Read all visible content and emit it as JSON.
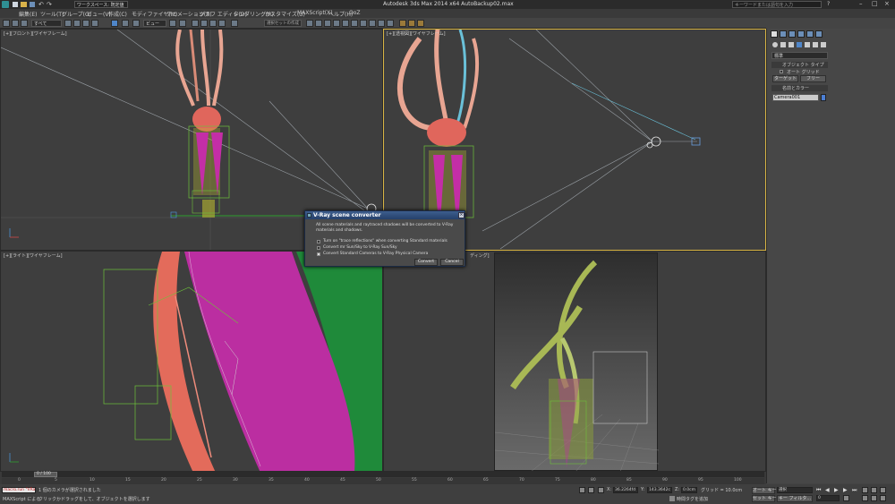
{
  "title_bar": {
    "workspace": "ワークスペース: 既定値",
    "title": "Autodesk 3ds Max 2014 x64   AutoBackup02.max",
    "search_placeholder": "キーワードまたは語句を入力"
  },
  "menu": [
    "編集(E)",
    "ツール(T)",
    "グループ(G)",
    "ビュー(V)",
    "作成(C)",
    "モディファイヤ(M)",
    "アニメーション(A)",
    "グラフ エディタ(D)",
    "レンダリング(R)",
    "カスタマイズ(U)",
    "MAXScript(X)",
    "ヘルプ(H)",
    "OoZ"
  ],
  "toolbar": {
    "selection_filter": "すべて",
    "view_dropdown": "ビュー",
    "named_selection": "選択セットの作成"
  },
  "viewports": {
    "front": "[+][フロント][ワイヤフレーム]",
    "perspective": "[+][透視図][ワイヤフレーム]",
    "right": "[+][ライト][ワイヤフレーム]",
    "camera_suffix": "ディング]"
  },
  "dialog": {
    "title": "V-Ray scene converter",
    "message": "All scene materials and raytraced shadows will be converted to V-Ray materials and shadows.",
    "options": [
      {
        "label": "Turn on \"trace reflections\" when converting Standard materials",
        "checked": false
      },
      {
        "label": "Convert mr Sun/Sky to V-Ray Sun/Sky",
        "checked": false
      },
      {
        "label": "Convert Standard Cameras to V-Ray Physical Camera",
        "checked": true
      }
    ],
    "convert": "Convert",
    "cancel": "Cancel"
  },
  "command_panel": {
    "category_dropdown": "標準",
    "rollout_object_type": "オブジェクト タイプ",
    "autogrid": "オート グリッド",
    "button_target": "ターゲット",
    "button_free": "フリー",
    "rollout_name_color": "名前とカラー",
    "object_name": "Camera001",
    "color": "#4c7fd4"
  },
  "timeline": {
    "frame": "0 / 100",
    "ticks": [
      "0",
      "5",
      "10",
      "15",
      "20",
      "25",
      "30",
      "35",
      "40",
      "45",
      "50",
      "55",
      "60",
      "65",
      "70",
      "75",
      "80",
      "85",
      "90",
      "95",
      "100"
    ]
  },
  "status": {
    "script_label": "macro.run \"VRa",
    "listener_label": "MAXScript による",
    "selected": "1 個のカメラが選択されました",
    "prompt": "クリックかドラッグをして、オブジェクトを選択します",
    "x_label": "X:",
    "x": "36.2264fd",
    "y_label": "Y:",
    "y": "143.3642c",
    "z_label": "Z:",
    "z": "0.0cm",
    "grid": "グリッド = 10.0cm",
    "time_tag": "時間タグを追加",
    "auto_key": "オート キー",
    "key_mode": "選択",
    "set_key": "セット キー",
    "key_filters": "キー フィルタ...",
    "frame": "0"
  }
}
